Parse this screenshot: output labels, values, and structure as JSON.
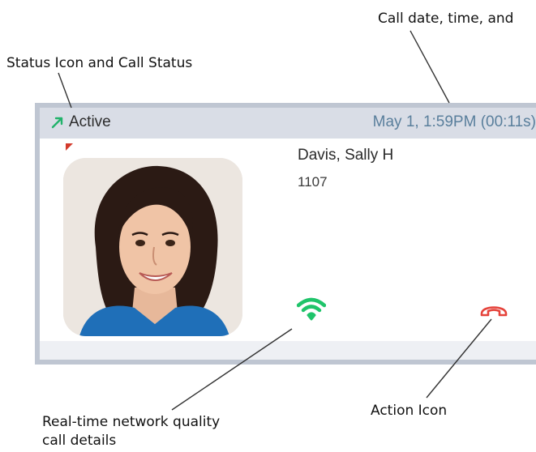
{
  "callouts": {
    "call_date": "Call date, time, and",
    "status": "Status Icon and Call Status",
    "network_line1": "Real-time network quality",
    "network_line2": "call details",
    "action": "Action Icon"
  },
  "call": {
    "status": "Active",
    "date_time": "May 1, 1:59PM (00:11s)",
    "contact_name": "Davis, Sally H",
    "extension": "1107",
    "status_icon": "outgoing-arrow-icon",
    "network_icon": "wifi-signal-icon",
    "action_icon": "hangup-phone-icon"
  },
  "colors": {
    "status_green": "#22b36b",
    "date_blue": "#5a7f9c",
    "network_green": "#1fc46a",
    "hangup_red": "#e5433b"
  }
}
